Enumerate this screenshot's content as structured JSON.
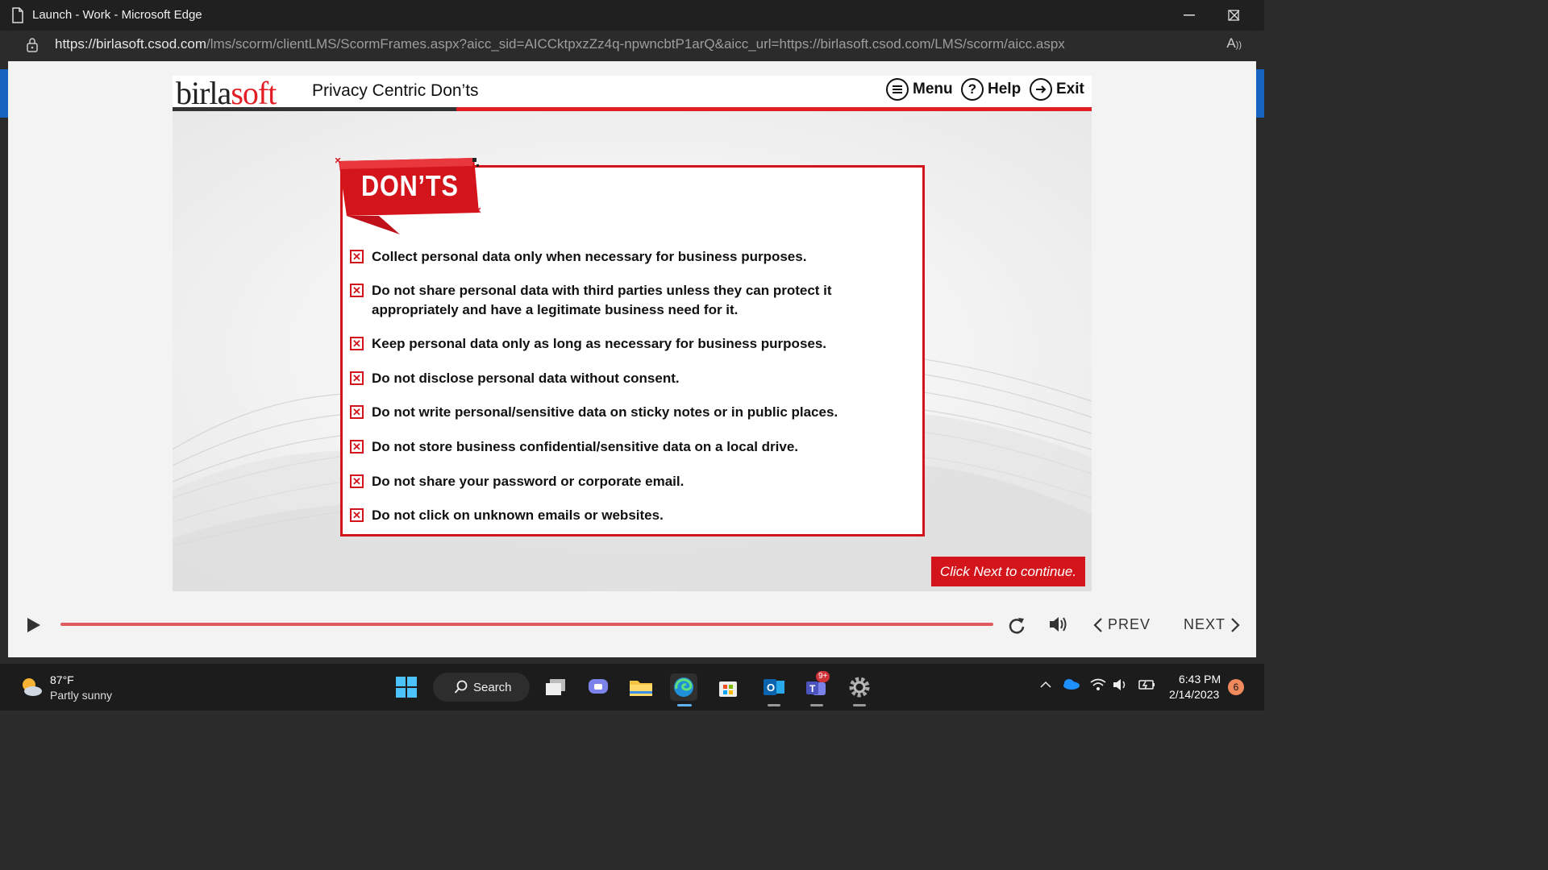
{
  "browser": {
    "window_title": "Launch - Work - Microsoft Edge",
    "url_domain": "https://birlasoft.csod.com",
    "url_path": "/lms/scorm/clientLMS/ScormFrames.aspx?aicc_sid=AICCktpxzZz4q-npwncbtP1arQ&aicc_url=https://birlasoft.csod.com/LMS/scorm/aicc.aspx"
  },
  "course": {
    "logo_part1": "birla",
    "logo_part2": "soft",
    "title": "Privacy Centric Don’ts",
    "nav": {
      "menu": "Menu",
      "help": "Help",
      "exit": "Exit"
    },
    "banner": "DON’TS",
    "items": [
      "Collect personal data only when necessary for business purposes.",
      "Do not share personal data with third parties unless they can protect it appropriately and have a legitimate business need for it.",
      "Keep personal data only as long as necessary for business purposes.",
      "Do not disclose personal data without consent.",
      "Do not write personal/sensitive data on sticky notes or in public places.",
      "Do not store business confidential/sensitive data on a local drive.",
      "Do not share your password or corporate email.",
      "Do not click on unknown emails or websites."
    ],
    "continue_label": "Click Next to continue."
  },
  "player": {
    "prev_label": "PREV",
    "next_label": "NEXT",
    "progress": 1.0
  },
  "taskbar": {
    "weather_temp": "87°F",
    "weather_desc": "Partly sunny",
    "search_label": "Search",
    "teams_badge": "9+",
    "time": "6:43 PM",
    "date": "2/14/2023",
    "notification_count": "6"
  },
  "colors": {
    "brand_red": "#d3141b",
    "progress": "#e15a5e"
  }
}
